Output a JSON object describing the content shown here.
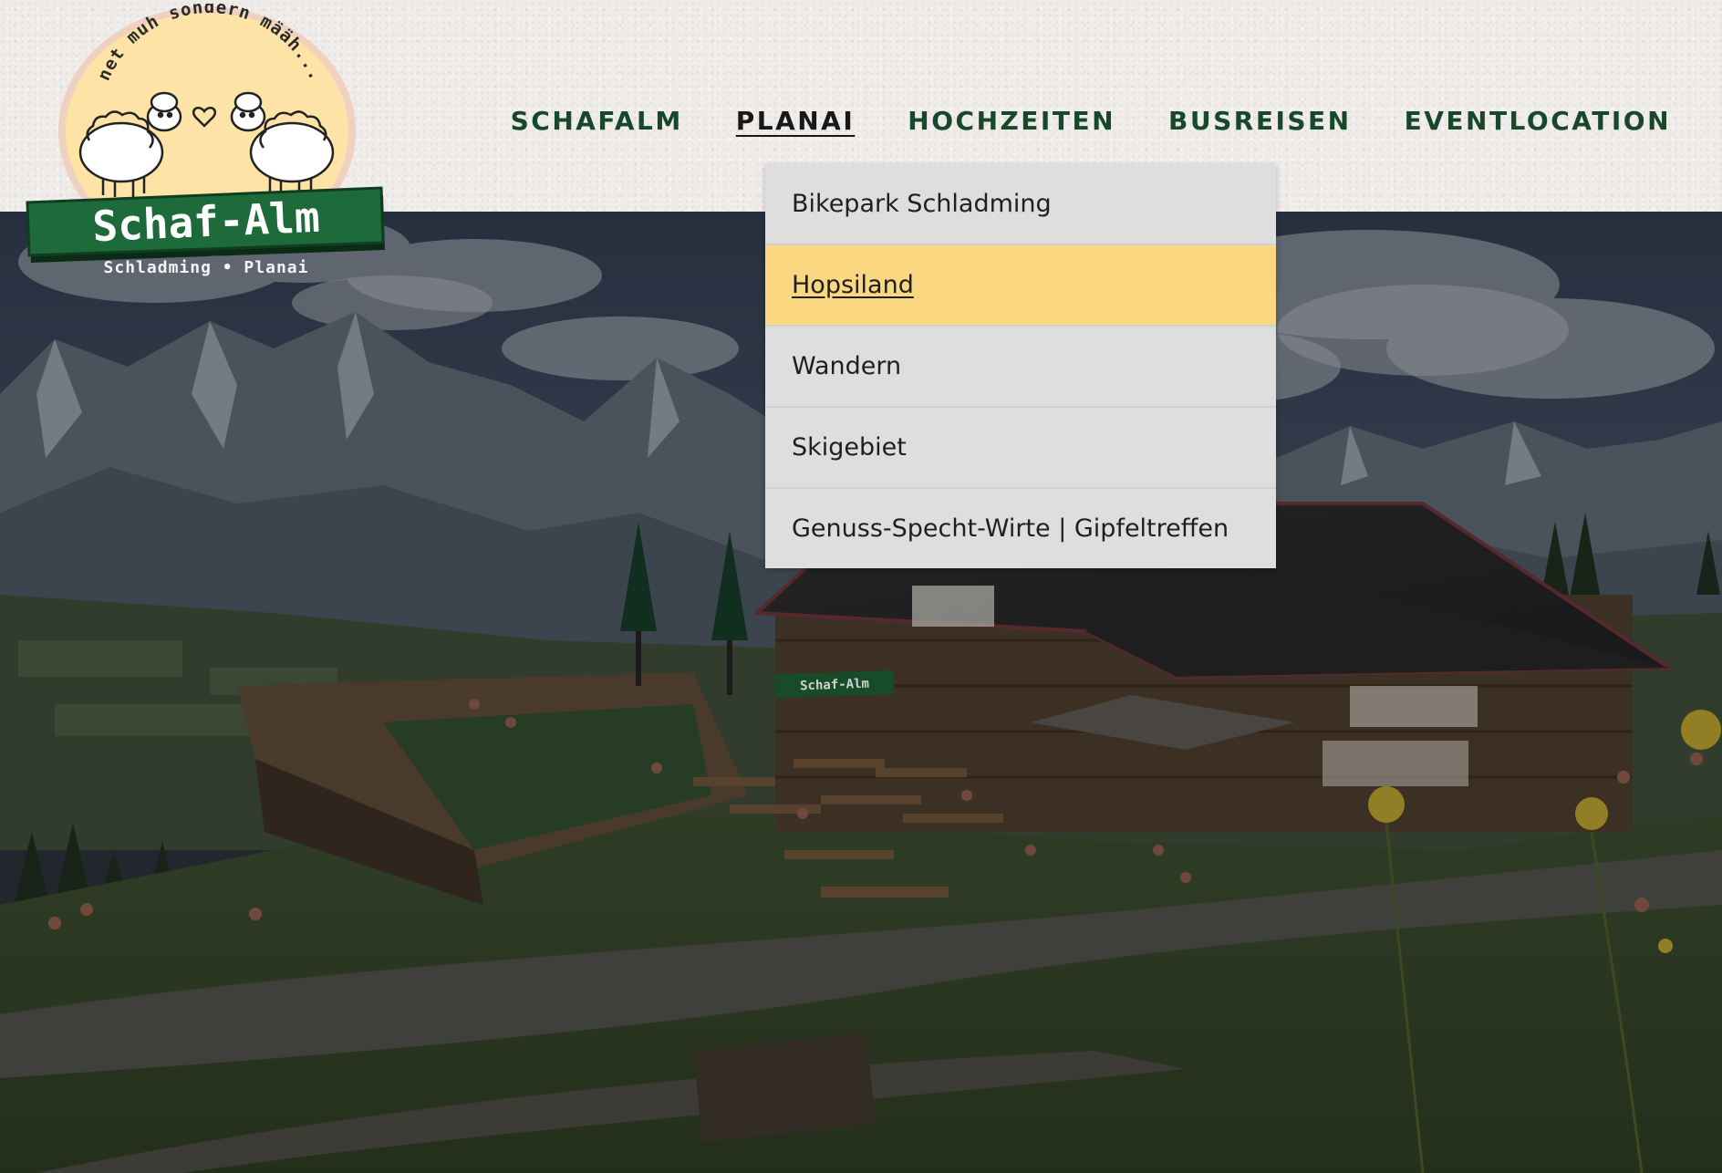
{
  "logo": {
    "name": "Schaf-Alm",
    "slogan": "net muh sondern määh...",
    "location": "Schladming • Planai"
  },
  "nav": {
    "items": [
      {
        "label": "SCHAFALM"
      },
      {
        "label": "PLANAI"
      },
      {
        "label": "HOCHZEITEN"
      },
      {
        "label": "BUSREISEN"
      },
      {
        "label": "EVENTLOCATION"
      }
    ],
    "active": "PLANAI"
  },
  "dropdown": {
    "items": [
      {
        "label": "Bikepark Schladming"
      },
      {
        "label": "Hopsiland"
      },
      {
        "label": "Wandern"
      },
      {
        "label": "Skigebiet"
      },
      {
        "label": "Genuss-Specht-Wirte | Gipfeltreffen"
      }
    ],
    "active": "Hopsiland"
  },
  "hero": {
    "sign_text": "Schaf-Alm"
  },
  "colors": {
    "nav_green": "#17482a",
    "highlight_yellow": "#fcd782",
    "dropdown_bg": "#dedede",
    "logo_banner_green": "#1d6b3a",
    "logo_circle": "#fde3a6"
  }
}
